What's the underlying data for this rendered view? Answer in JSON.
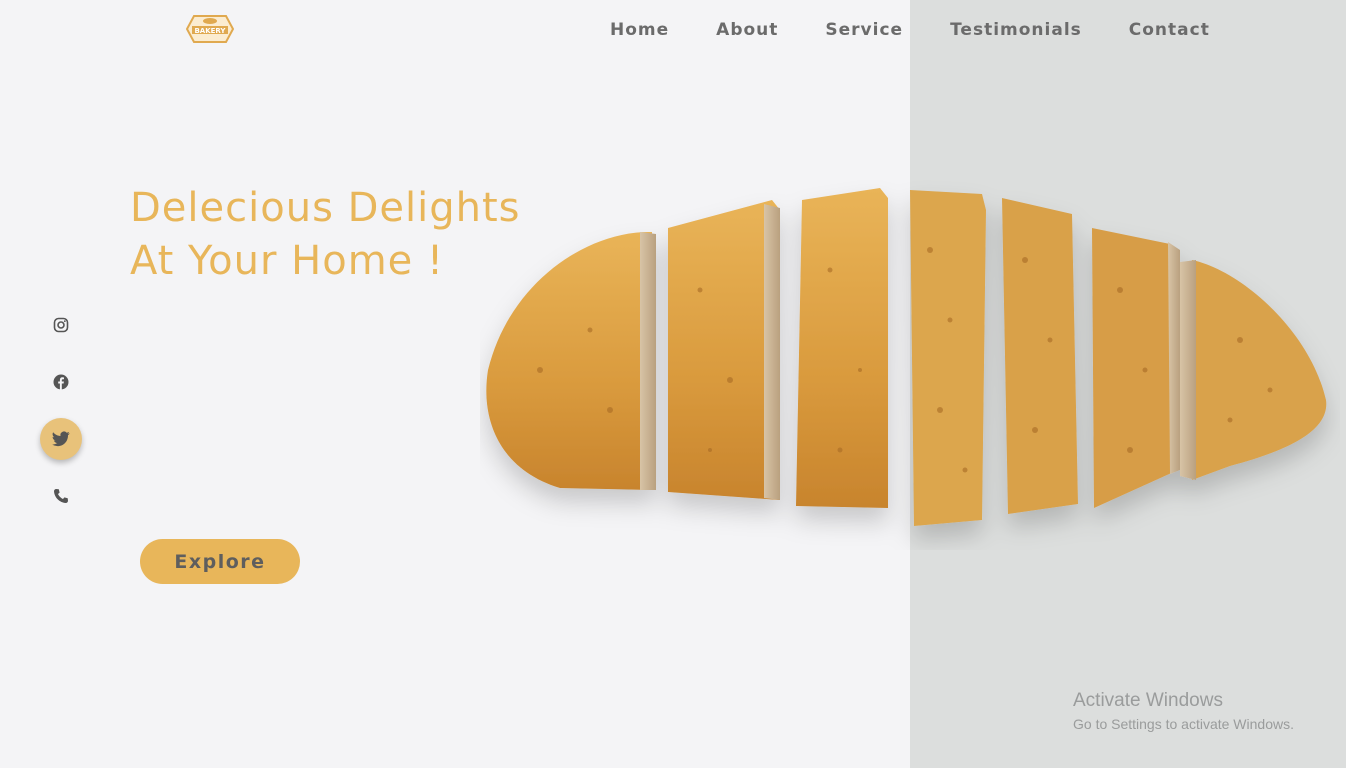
{
  "brand": {
    "logo_text": "BAKERY",
    "accent": "#e8b65a"
  },
  "nav": {
    "items": [
      "Home",
      "About",
      "Service",
      "Testimonials",
      "Contact"
    ]
  },
  "hero": {
    "headline_line1": "Delecious Delights",
    "headline_line2": "At Your Home !",
    "explore_label": "Explore"
  },
  "social": {
    "icons": [
      "instagram-icon",
      "facebook-icon",
      "twitter-icon",
      "phone-icon"
    ],
    "active": "twitter-icon"
  },
  "watermark": {
    "title": "Activate Windows",
    "subtitle": "Go to Settings to activate Windows."
  }
}
